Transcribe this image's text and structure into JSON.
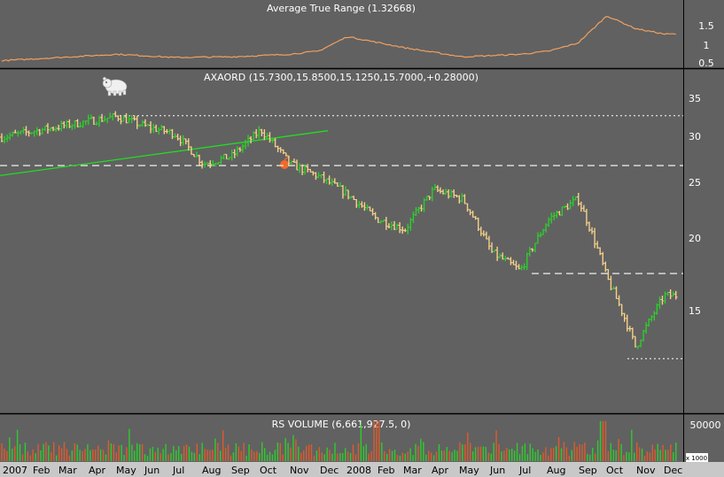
{
  "chart_data": [
    {
      "type": "line",
      "title": "Average True Range (1.32668)",
      "yticks": [
        0.5,
        1.0,
        1.5
      ],
      "ylim": [
        0.35,
        1.95
      ],
      "color": "#f0a060",
      "x": [
        "2007-01",
        "2007-03",
        "2007-05",
        "2007-07",
        "2007-09",
        "2007-11",
        "2007-12",
        "2008-01",
        "2008-03",
        "2008-05",
        "2008-07",
        "2008-08",
        "2008-09",
        "2008-10",
        "2008-11",
        "2008-12"
      ],
      "values": [
        0.5,
        0.6,
        0.7,
        0.6,
        0.62,
        0.7,
        0.8,
        1.25,
        0.9,
        0.62,
        0.7,
        0.8,
        1.05,
        1.9,
        1.5,
        1.33
      ]
    },
    {
      "type": "bar",
      "title": "AXAORD (15.7300,15.8500,15.1250,15.7000,+0.28000)",
      "yticks": [
        15,
        20,
        25,
        30,
        35
      ],
      "scale": "log",
      "ylim": [
        10,
        39
      ],
      "up_color": "#2ecc2e",
      "down_color": "#f5d08a",
      "trendline_color": "#22dd22",
      "x": [
        "2007-01",
        "2007-03",
        "2007-05",
        "2007-06",
        "2007-07",
        "2007-08",
        "2007-09",
        "2007-10",
        "2007-11",
        "2007-12",
        "2008-01",
        "2008-02",
        "2008-03",
        "2008-04",
        "2008-05",
        "2008-06",
        "2008-07",
        "2008-08",
        "2008-09",
        "2008-10",
        "2008-11",
        "2008-12"
      ],
      "close": [
        31.5,
        33,
        34.5,
        33,
        32,
        28,
        29,
        32.5,
        28,
        26.5,
        24.5,
        22,
        21,
        25,
        24,
        19,
        17.5,
        22,
        24,
        17,
        12.5,
        15.7
      ]
    },
    {
      "type": "bar",
      "title": "RS VOLUME (6,661,927.5, 0)",
      "yticks": [
        50000
      ],
      "ylim": [
        0,
        70000
      ],
      "unit_label": "x 1000",
      "up_color": "#2ecc2e",
      "down_color": "#e05a2a",
      "x_labels": [
        "2007",
        "Feb",
        "Mar",
        "Apr",
        "May",
        "Jun",
        "Jul",
        "Aug",
        "Sep",
        "Oct",
        "Nov",
        "Dec",
        "2008",
        "Feb",
        "Mar",
        "Apr",
        "May",
        "Jun",
        "Jul",
        "Aug",
        "Sep",
        "Oct",
        "Nov",
        "Dec"
      ]
    }
  ]
}
